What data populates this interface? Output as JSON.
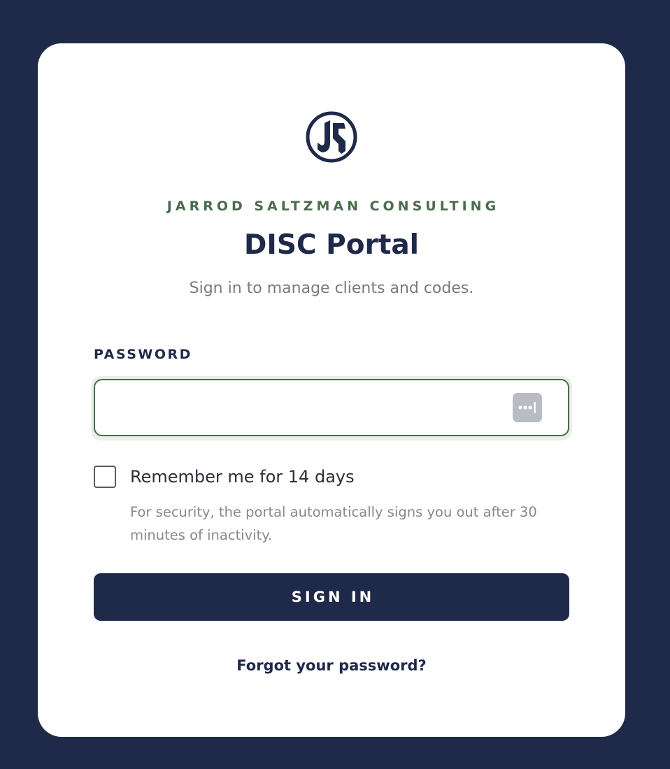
{
  "brand": {
    "logo_icon": "js-monogram-logo",
    "name": "JARROD SALTZMAN CONSULTING"
  },
  "header": {
    "title": "DISC Portal",
    "subtitle": "Sign in to manage clients and codes."
  },
  "form": {
    "password_label": "PASSWORD",
    "password_value": "",
    "password_placeholder": "",
    "password_manager_icon": "password-manager-key-icon",
    "remember_label": "Remember me for 14 days",
    "remember_checked": false,
    "hint": "For security, the portal automatically signs you out after 30 minutes of inactivity.",
    "submit_label": "SIGN IN",
    "forgot_label": "Forgot your password?"
  },
  "colors": {
    "background": "#1f2a4a",
    "card": "#ffffff",
    "primary": "#1f2a4a",
    "accent_green": "#4a6b4c",
    "muted_text": "#888888"
  }
}
